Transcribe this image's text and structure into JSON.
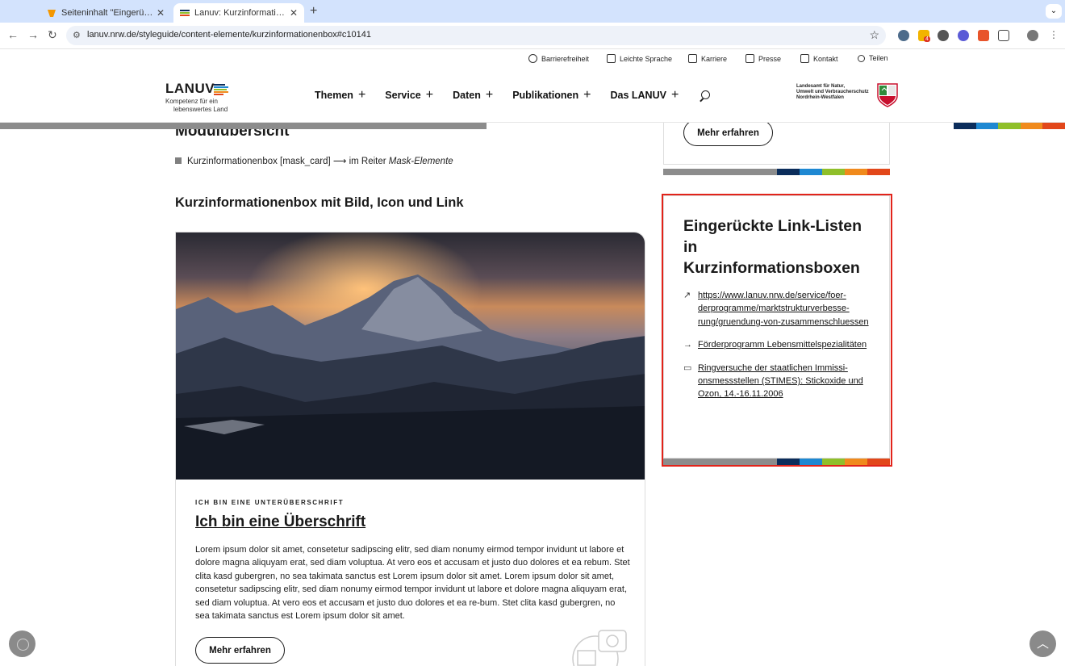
{
  "browser": {
    "tabs": [
      {
        "title": "Seiteninhalt \"Eingerückte Link-Listen\"",
        "active": false
      },
      {
        "title": "Lanuv: Kurzinformationenbox",
        "active": true
      }
    ],
    "new_tab": "+",
    "url": "lanuv.nrw.de/styleguide/content-elemente/kurzinformationenbox#c10141",
    "ext_badge": "4"
  },
  "utility_nav": [
    {
      "label": "Barrierefreiheit",
      "icon": "accessibility-icon"
    },
    {
      "label": "Leichte Sprache",
      "icon": "easy-language-icon"
    },
    {
      "label": "Karriere",
      "icon": "briefcase-icon"
    },
    {
      "label": "Presse",
      "icon": "newspaper-icon"
    },
    {
      "label": "Kontakt",
      "icon": "contact-icon"
    },
    {
      "label": "Teilen",
      "icon": "share-icon"
    }
  ],
  "logo": {
    "word": "LANUV",
    "tagline_1": "Kompetenz für ein",
    "tagline_2": "lebenswertes Land"
  },
  "main_nav": [
    "Themen",
    "Service",
    "Daten",
    "Publikationen",
    "Das LANUV"
  ],
  "agency": {
    "line1": "Landesamt für Natur,",
    "line2": "Umwelt und Verbraucherschutz",
    "line3": "Nordrhein-Westfalen"
  },
  "module": {
    "title": "Modulübersicht",
    "item_text": "Kurzinformationenbox [mask_card] ⟶ im Reiter ",
    "item_em": "Mask-Elemente"
  },
  "section_title": "Kurzinformationenbox mit Bild, Icon und Link",
  "card": {
    "kicker": "ICH BIN EINE UNTERÜBERSCHRIFT",
    "heading": "Ich bin eine Überschrift",
    "text": "Lorem ipsum dolor sit amet, consetetur sadipscing elitr, sed diam nonumy eirmod tempor invidunt ut labore et dolore magna aliquyam erat, sed diam voluptua. At vero eos et accusam et justo duo dolores et ea rebum. Stet clita kasd gubergren, no sea takimata sanctus est Lorem ipsum dolor sit amet. Lorem ipsum dolor sit amet, consetetur sadipscing elitr, sed diam nonumy eirmod tempor invidunt ut labore et dolore magna aliquyam erat, sed diam voluptua. At vero eos et accusam et justo duo dolores et ea re-bum. Stet clita kasd gubergren, no sea takimata sanctus est Lorem ipsum dolor sit amet.",
    "button": "Mehr erfahren"
  },
  "side_top": {
    "button": "Mehr erfahren"
  },
  "link_card": {
    "title": "Eingerückte Link-Listen in Kurzinformationsboxen",
    "links": [
      {
        "icon": "external-link-icon",
        "glyph": "↗",
        "text": "https://www.lanuv.nrw.de/service/foer-derprogramme/marktstrukturverbesse-rung/gruendung-von-zusammenschluessen"
      },
      {
        "icon": "arrow-right-icon",
        "glyph": "→",
        "text": "Förderprogramm Lebensmittelspezialitäten"
      },
      {
        "icon": "book-icon",
        "glyph": "▭",
        "text": "Ringversuche der staatlichen Immissi-onsmessstellen (STIMES): Stickoxide und Ozon, 14.-16.11.2006"
      }
    ]
  },
  "colors": {
    "strip": [
      "#8c8c8c",
      "#0b2d5b",
      "#1e88d2",
      "#8fbf2a",
      "#f08a1c",
      "#e2471a"
    ],
    "highlight": "#e2231a"
  },
  "scroll_top_glyph": "︿"
}
